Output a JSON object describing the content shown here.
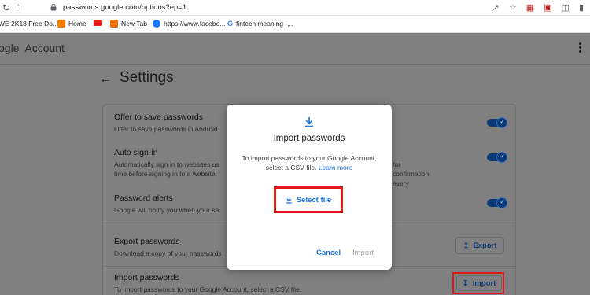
{
  "browser": {
    "url": "passwords.google.com/options?ep=1",
    "bookmarks": [
      {
        "label": "WE 2K18 Free Do...",
        "icon": "page-icon"
      },
      {
        "label": "Home",
        "icon": "home-icon"
      },
      {
        "label": "",
        "icon": "youtube-icon"
      },
      {
        "label": "New Tab",
        "icon": "new-tab-icon"
      },
      {
        "label": "https://www.facebo...",
        "icon": "facebook-icon"
      },
      {
        "label": "fintech meaning -...",
        "icon": "google-icon"
      }
    ]
  },
  "header": {
    "brand_suffix": "ogle",
    "brand_word": "Account"
  },
  "page": {
    "title": "Settings"
  },
  "settings": [
    {
      "title": "Offer to save passwords",
      "desc": "Offer to save passwords in Android",
      "toggle": true
    },
    {
      "title": "Auto sign-in",
      "desc1": "Automatically sign in to websites us",
      "desc1_tail": "for confirmation every",
      "desc2": "time before signing in to a website.",
      "toggle": true
    },
    {
      "title": "Password alerts",
      "desc": "Google will notify you when your sa",
      "toggle": true
    },
    {
      "title": "Export passwords",
      "desc": "Download a copy of your passwords",
      "button": "Export"
    },
    {
      "title": "Import passwords",
      "desc": "To import passwords to your Google Account, select a CSV file.",
      "button": "Import"
    }
  ],
  "modal": {
    "title": "Import passwords",
    "desc": "To import passwords to your Google Account, select a CSV file.",
    "link": "Learn more",
    "select_file": "Select file",
    "cancel": "Cancel",
    "import": "Import"
  },
  "colors": {
    "accent": "#1a73e8",
    "highlight": "#e01818",
    "overlay": "#7f7f7f"
  }
}
